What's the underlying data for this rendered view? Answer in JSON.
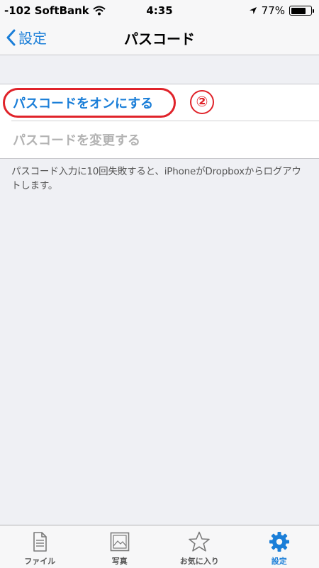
{
  "status_bar": {
    "carrier": "-102 SoftBank",
    "time": "4:35",
    "battery": "77%",
    "battery_level": 0.77
  },
  "nav": {
    "back_label": "設定",
    "title": "パスコード"
  },
  "settings": {
    "rows": [
      {
        "label": "パスコードをオンにする"
      },
      {
        "label": "パスコードを変更する"
      }
    ],
    "footer": "パスコード入力に10回失敗すると、iPhoneがDropboxからログアウトします。"
  },
  "annotation": {
    "step": "②",
    "color": "#e0232a"
  },
  "tabs": [
    {
      "label": "ファイル",
      "icon": "file-icon"
    },
    {
      "label": "写真",
      "icon": "photo-icon"
    },
    {
      "label": "お気に入り",
      "icon": "star-icon"
    },
    {
      "label": "設定",
      "icon": "gear-icon",
      "active": true
    }
  ],
  "colors": {
    "accent": "#1a7ed8",
    "disabled": "#b3b3b3",
    "background": "#eff0f4"
  }
}
